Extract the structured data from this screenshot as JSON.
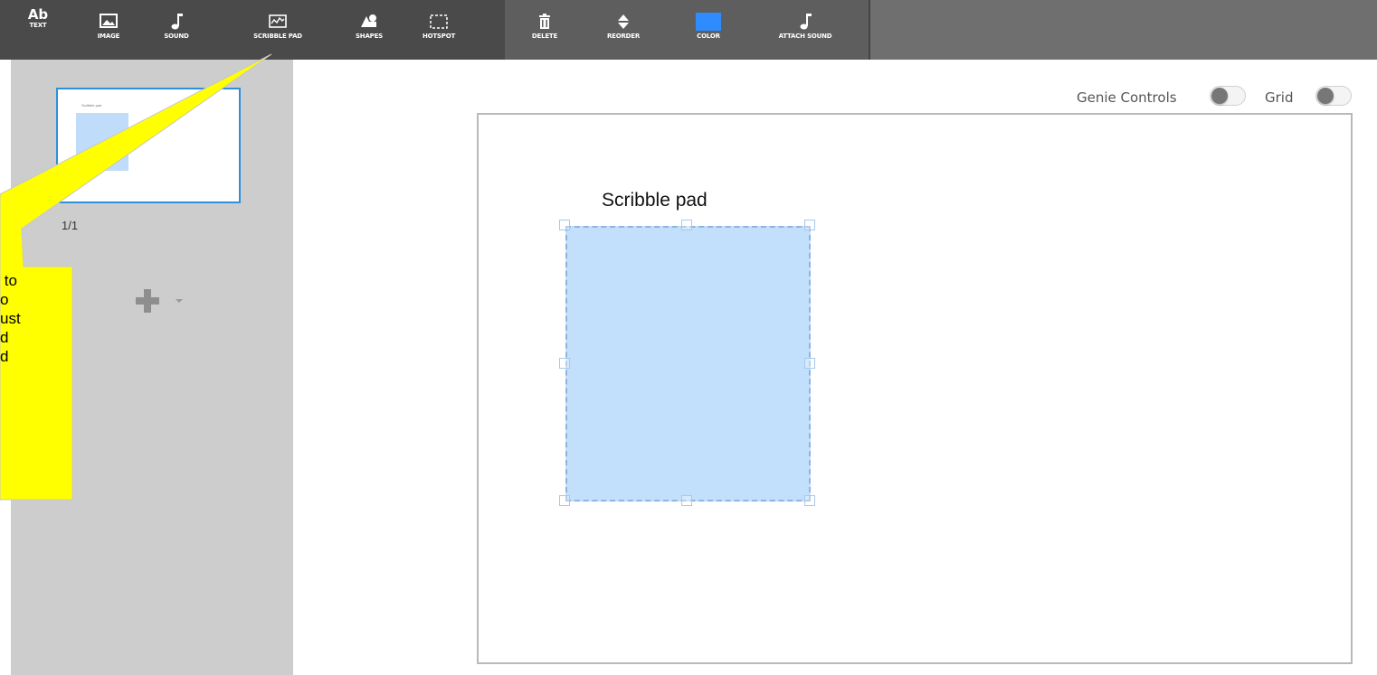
{
  "toolbar": {
    "tools": [
      {
        "label": "TEXT",
        "icon": "text-icon",
        "glyph": "Ab"
      },
      {
        "label": "IMAGE",
        "icon": "image-icon"
      },
      {
        "label": "SOUND",
        "icon": "music-note-icon"
      },
      {
        "label": "SCRIBBLE PAD",
        "icon": "scribble-pad-icon"
      },
      {
        "label": "SHAPES",
        "icon": "shapes-icon"
      },
      {
        "label": "HOTSPOT",
        "icon": "hotspot-icon"
      },
      {
        "label": "DELETE",
        "icon": "trash-icon"
      },
      {
        "label": "REORDER",
        "icon": "reorder-icon"
      },
      {
        "label": "COLOR",
        "icon": "color-swatch-icon"
      },
      {
        "label": "ATTACH SOUND",
        "icon": "music-note-icon"
      }
    ],
    "color_swatch": "#2f8cff"
  },
  "sidebar": {
    "thumbnail_label": "Scribble pad",
    "page_indicator": "1/1",
    "add_page_icon": "plus-icon"
  },
  "callout": {
    "text": " to\no\nust\nd\nd",
    "color": "#ffff00"
  },
  "controls": {
    "genie_label": "Genie Controls",
    "grid_label": "Grid"
  },
  "canvas": {
    "scribble_title": "Scribble pad",
    "pad_color": "#c2dffc"
  }
}
